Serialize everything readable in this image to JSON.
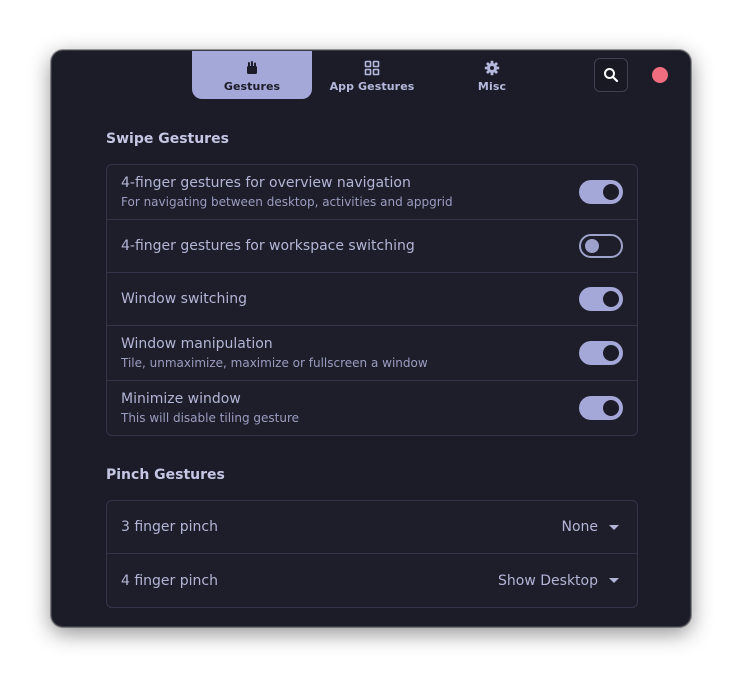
{
  "tabs": [
    {
      "label": "Gestures",
      "icon": "gestures-icon",
      "active": true
    },
    {
      "label": "App Gestures",
      "icon": "grid-icon",
      "active": false
    },
    {
      "label": "Misc",
      "icon": "gear-icon",
      "active": false
    }
  ],
  "header": {
    "search_icon": "search-icon",
    "close_icon": "close-icon"
  },
  "swipe": {
    "title": "Swipe Gestures",
    "rows": [
      {
        "title": "4-finger gestures for overview navigation",
        "subtitle": "For navigating between desktop, activities and appgrid",
        "enabled": true
      },
      {
        "title": "4-finger gestures for workspace switching",
        "subtitle": "",
        "enabled": false
      },
      {
        "title": "Window switching",
        "subtitle": "",
        "enabled": true
      },
      {
        "title": "Window manipulation",
        "subtitle": "Tile, unmaximize, maximize or fullscreen a window",
        "enabled": true
      },
      {
        "title": "Minimize window",
        "subtitle": "This will disable tiling gesture",
        "enabled": true
      }
    ]
  },
  "pinch": {
    "title": "Pinch Gestures",
    "rows": [
      {
        "title": "3 finger pinch",
        "value": "None"
      },
      {
        "title": "4 finger pinch",
        "value": "Show Desktop"
      }
    ]
  },
  "colors": {
    "accent": "#a4a8d8",
    "window_bg": "#1c1c28",
    "close": "#f06c7f"
  }
}
